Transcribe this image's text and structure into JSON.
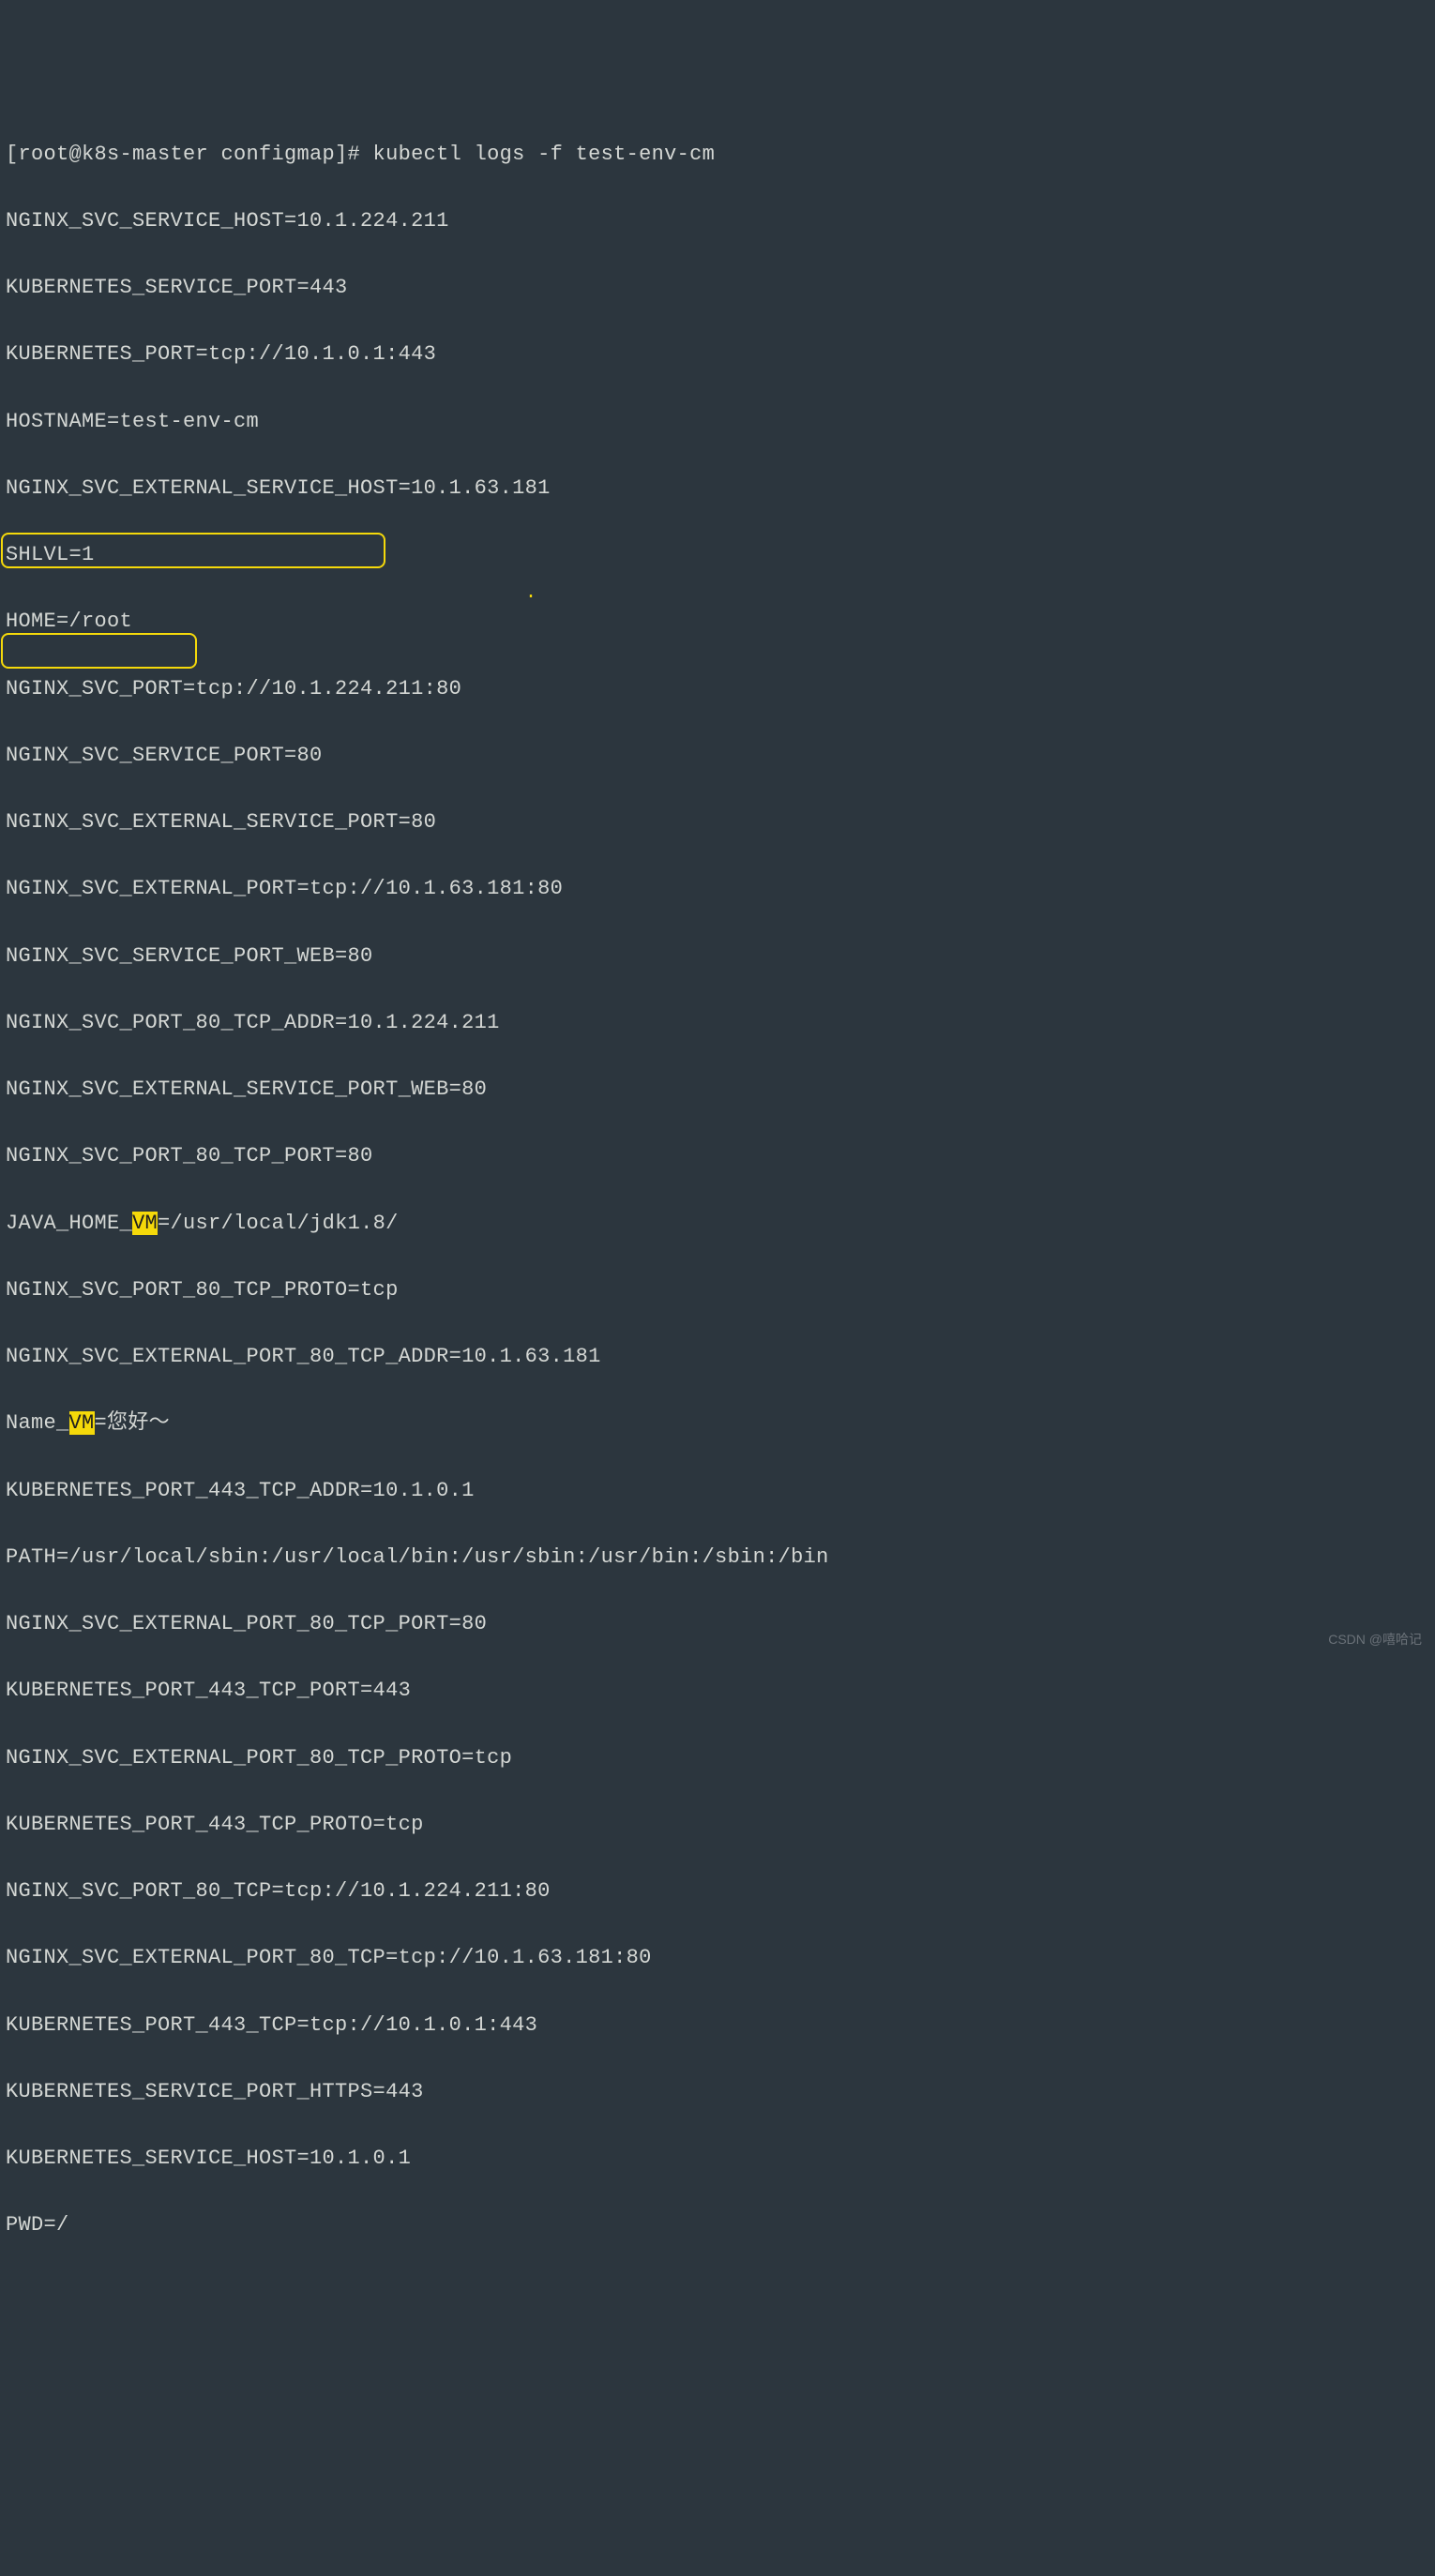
{
  "prompt": "[root@k8s-master configmap]# kubectl logs -f test-env-cm",
  "lines": {
    "l1": "NGINX_SVC_SERVICE_HOST=10.1.224.211",
    "l2": "KUBERNETES_SERVICE_PORT=443",
    "l3": "KUBERNETES_PORT=tcp://10.1.0.1:443",
    "l4": "HOSTNAME=test-env-cm",
    "l5": "NGINX_SVC_EXTERNAL_SERVICE_HOST=10.1.63.181",
    "l6": "SHLVL=1",
    "l7": "HOME=/root",
    "l8": "NGINX_SVC_PORT=tcp://10.1.224.211:80",
    "l9": "NGINX_SVC_SERVICE_PORT=80",
    "l10": "NGINX_SVC_EXTERNAL_SERVICE_PORT=80",
    "l11": "NGINX_SVC_EXTERNAL_PORT=tcp://10.1.63.181:80",
    "l12": "NGINX_SVC_SERVICE_PORT_WEB=80",
    "l13": "NGINX_SVC_PORT_80_TCP_ADDR=10.1.224.211",
    "l14": "NGINX_SVC_EXTERNAL_SERVICE_PORT_WEB=80",
    "l15": "NGINX_SVC_PORT_80_TCP_PORT=80",
    "l16_pre": "JAVA_HOME_",
    "l16_hl": "VM",
    "l16_post": "=/usr/local/jdk1.8/",
    "l17": "NGINX_SVC_PORT_80_TCP_PROTO=tcp",
    "l18": "NGINX_SVC_EXTERNAL_PORT_80_TCP_ADDR=10.1.63.181",
    "l19_pre": "Name_",
    "l19_hl": "VM",
    "l19_post": "=您好～",
    "l20": "KUBERNETES_PORT_443_TCP_ADDR=10.1.0.1",
    "l21": "PATH=/usr/local/sbin:/usr/local/bin:/usr/sbin:/usr/bin:/sbin:/bin",
    "l22": "NGINX_SVC_EXTERNAL_PORT_80_TCP_PORT=80",
    "l23": "KUBERNETES_PORT_443_TCP_PORT=443",
    "l24": "NGINX_SVC_EXTERNAL_PORT_80_TCP_PROTO=tcp",
    "l25": "KUBERNETES_PORT_443_TCP_PROTO=tcp",
    "l26": "NGINX_SVC_PORT_80_TCP=tcp://10.1.224.211:80",
    "l27": "NGINX_SVC_EXTERNAL_PORT_80_TCP=tcp://10.1.63.181:80",
    "l28": "KUBERNETES_PORT_443_TCP=tcp://10.1.0.1:443",
    "l29": "KUBERNETES_SERVICE_PORT_HTTPS=443",
    "l30": "KUBERNETES_SERVICE_HOST=10.1.0.1",
    "l31": "PWD=/"
  },
  "watermark": "CSDN @嘻哈记"
}
